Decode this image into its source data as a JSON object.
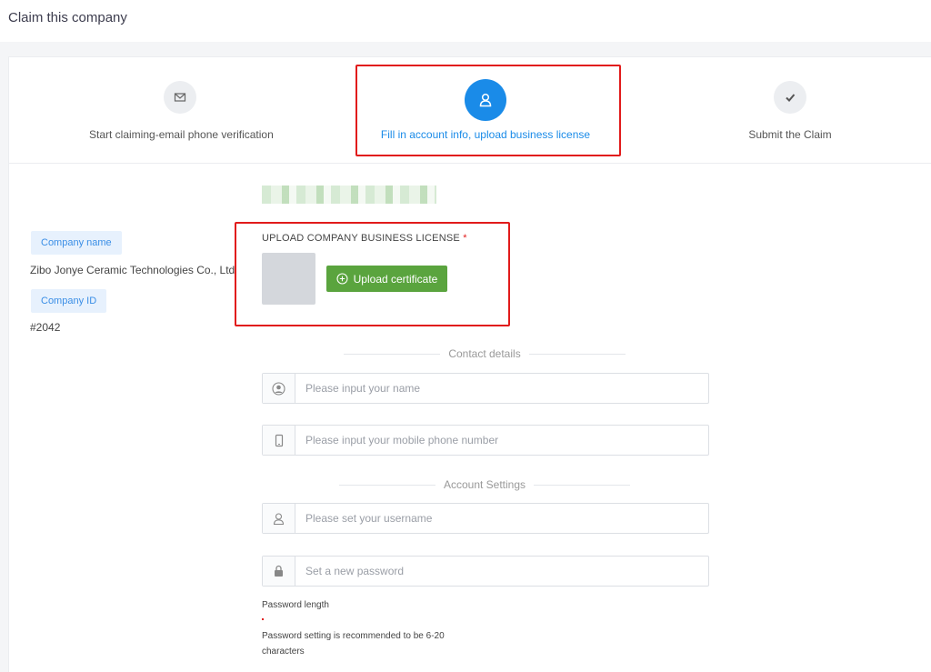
{
  "header": {
    "title": "Claim this company"
  },
  "steps": [
    {
      "label": "Start claiming-email phone verification",
      "icon": "envelope-icon",
      "state": "done"
    },
    {
      "label": "Fill in account info, upload business license",
      "icon": "user-icon",
      "state": "active"
    },
    {
      "label": "Submit the Claim",
      "icon": "checkmark-icon",
      "state": "pending"
    }
  ],
  "company": {
    "name_tag": "Company name",
    "name_value": "Zibo Jonye Ceramic Technologies Co., Ltd",
    "id_tag": "Company ID",
    "id_value": "#2042"
  },
  "upload": {
    "label": "UPLOAD COMPANY BUSINESS LICENSE",
    "required_mark": "*",
    "button_label": "Upload certificate"
  },
  "contact": {
    "section_title": "Contact details",
    "name_placeholder": "Please input your name",
    "phone_placeholder": "Please input your mobile phone number"
  },
  "account": {
    "section_title": "Account Settings",
    "username_placeholder": "Please set your username",
    "password_placeholder": "Set a new password",
    "hint_title": "Password length",
    "hint_line1": "Password setting is recommended to be 6-20",
    "hint_line2": "characters"
  },
  "colors": {
    "accent": "#1a8be8",
    "upload_button": "#5aa43e",
    "highlight": "#e11b1b",
    "tag_background": "#e7f1fd"
  }
}
